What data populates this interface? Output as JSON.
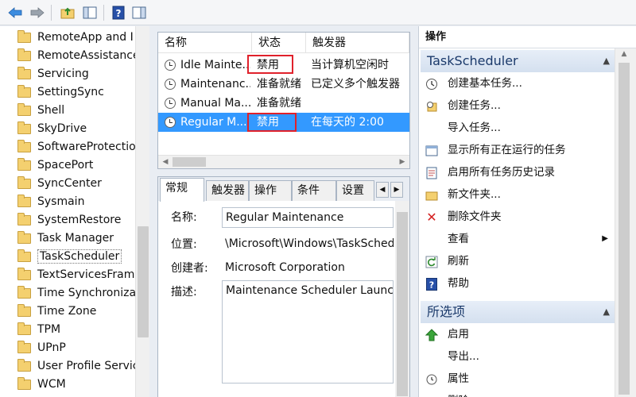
{
  "toolbar": {
    "icons": [
      "back-arrow-icon",
      "forward-arrow-icon",
      "up-folder-icon",
      "show-hide-tree-icon",
      "help-icon",
      "show-hide-action-pane-icon"
    ]
  },
  "tree": {
    "items": [
      {
        "label": "RemoteApp and I"
      },
      {
        "label": "RemoteAssistance"
      },
      {
        "label": "Servicing"
      },
      {
        "label": "SettingSync"
      },
      {
        "label": "Shell"
      },
      {
        "label": "SkyDrive"
      },
      {
        "label": "SoftwareProtection"
      },
      {
        "label": "SpacePort"
      },
      {
        "label": "SyncCenter"
      },
      {
        "label": "Sysmain"
      },
      {
        "label": "SystemRestore"
      },
      {
        "label": "Task Manager"
      },
      {
        "label": "TaskScheduler"
      },
      {
        "label": "TextServicesFrame"
      },
      {
        "label": "Time Synchronizati"
      },
      {
        "label": "Time Zone"
      },
      {
        "label": "TPM"
      },
      {
        "label": "UPnP"
      },
      {
        "label": "User Profile Servic"
      },
      {
        "label": "WCM"
      }
    ],
    "selected": "TaskScheduler"
  },
  "tasks": {
    "columns": [
      "名称",
      "状态",
      "触发器"
    ],
    "rows": [
      {
        "name": "Idle Mainte...",
        "status": "禁用",
        "trigger": "当计算机空闲时"
      },
      {
        "name": "Maintenanc...",
        "status": "准备就绪",
        "trigger": "已定义多个触发器"
      },
      {
        "name": "Manual Ma...",
        "status": "准备就绪",
        "trigger": ""
      },
      {
        "name": "Regular M...",
        "status": "禁用",
        "trigger": "在每天的 2:00"
      }
    ]
  },
  "detail": {
    "tabs": [
      "常规",
      "触发器",
      "操作",
      "条件",
      "设置"
    ],
    "fields": {
      "name_label": "名称:",
      "name_value": "Regular Maintenance",
      "location_label": "位置:",
      "location_value": "\\Microsoft\\Windows\\TaskSched",
      "author_label": "创建者:",
      "author_value": "Microsoft Corporation",
      "desc_label": "描述:",
      "desc_value": "Maintenance Scheduler Launch"
    }
  },
  "actions": {
    "title": "操作",
    "section1": "TaskScheduler",
    "items1": [
      {
        "label": "创建基本任务...",
        "icon": "basic-task-icon"
      },
      {
        "label": "创建任务...",
        "icon": "create-task-icon"
      },
      {
        "label": "导入任务...",
        "icon": ""
      },
      {
        "label": "显示所有正在运行的任务",
        "icon": "running-tasks-icon"
      },
      {
        "label": "启用所有任务历史记录",
        "icon": "history-icon"
      },
      {
        "label": "新文件夹...",
        "icon": "new-folder-icon"
      },
      {
        "label": "删除文件夹",
        "icon": "delete-icon"
      },
      {
        "label": "查看",
        "icon": ""
      },
      {
        "label": "刷新",
        "icon": "refresh-icon"
      },
      {
        "label": "帮助",
        "icon": "help-icon"
      }
    ],
    "section2": "所选项",
    "items2": [
      {
        "label": "启用",
        "icon": "enable-arrow-icon"
      },
      {
        "label": "导出...",
        "icon": ""
      },
      {
        "label": "属性",
        "icon": "properties-icon"
      },
      {
        "label": "删除",
        "icon": "delete-icon"
      }
    ]
  },
  "colors": {
    "selection": "#3399ff",
    "highlight_box": "#e0212b",
    "action_header": "#d4e0ef"
  }
}
